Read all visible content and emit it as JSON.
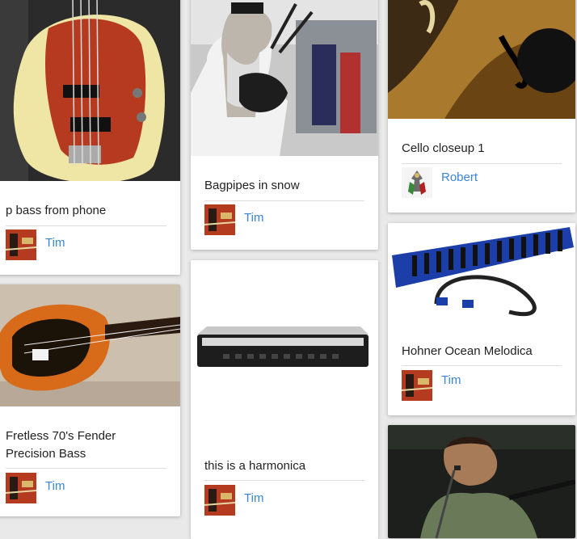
{
  "cards": [
    {
      "title": "p bass from phone",
      "author": "Tim",
      "avatar": "tim-avatar"
    },
    {
      "title": "Fretless 70's Fender Precision Bass",
      "author": "Tim",
      "avatar": "tim-avatar"
    },
    {
      "title": "Bagpipes in snow",
      "author": "Tim",
      "avatar": "tim-avatar"
    },
    {
      "title": "this is a harmonica",
      "author": "Tim",
      "avatar": "tim-avatar"
    },
    {
      "title": "Cello closeup 1",
      "author": "Robert",
      "avatar": "robert-avatar"
    },
    {
      "title": "Hohner Ocean Melodica",
      "author": "Tim",
      "avatar": "tim-avatar"
    },
    {
      "title": "",
      "author": "",
      "avatar": ""
    }
  ],
  "colors": {
    "author_link": "#3a86d6",
    "background": "#e9e9e9",
    "card": "#ffffff"
  }
}
